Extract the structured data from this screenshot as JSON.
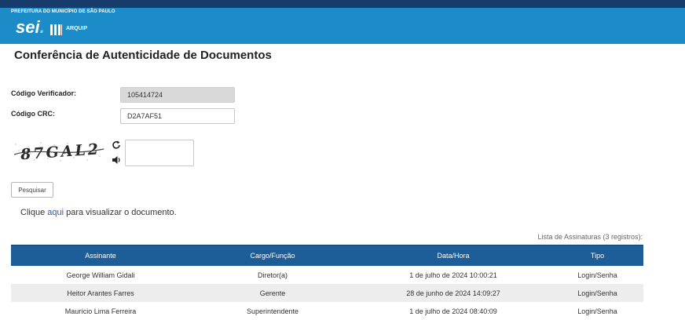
{
  "header": {
    "government_name": "PREFEITURA DO MUNICÍPIO DE SÃO PAULO",
    "logo_text": "sei",
    "logo_subtitle": "ARQUIP"
  },
  "page": {
    "title": "Conferência de Autenticidade de Documentos"
  },
  "form": {
    "verifier_label": "Código Verificador:",
    "verifier_value": "105414724",
    "crc_label": "Código CRC:",
    "crc_value": "D2A7AF51",
    "captcha_text": "87GAL2",
    "captcha_input_value": "",
    "search_button": "Pesquisar"
  },
  "document_link": {
    "prefix": "Clique ",
    "link_text": "aqui",
    "suffix": " para visualizar o documento."
  },
  "signatures": {
    "caption": "Lista de Assinaturas (3 registros):",
    "columns": [
      "Assinante",
      "Cargo/Função",
      "Data/Hora",
      "Tipo"
    ],
    "rows": [
      [
        "George William Gidali",
        "Diretor(a)",
        "1 de julho de 2024 10:00:21",
        "Login/Senha"
      ],
      [
        "Heitor Arantes Farres",
        "Gerente",
        "28 de junho de 2024 14:09:27",
        "Login/Senha"
      ],
      [
        "Maurício Lima Ferreira",
        "Superintendente",
        "1 de julho de 2024 08:40:09",
        "Login/Senha"
      ]
    ]
  },
  "colors": {
    "header_blue": "#1b8cc8",
    "header_top_strip": "#173b6b",
    "table_header": "#1d5d98",
    "link": "#2a57b8"
  },
  "icons": [
    "refresh-icon",
    "audio-icon"
  ]
}
